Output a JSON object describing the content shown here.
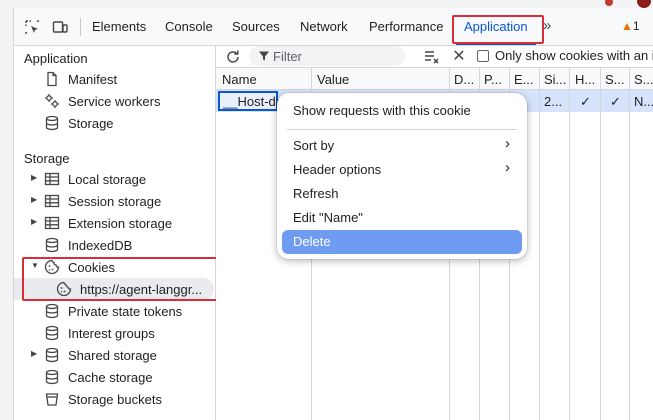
{
  "tabs": {
    "items": [
      {
        "label": "Elements",
        "active": false
      },
      {
        "label": "Console",
        "active": false
      },
      {
        "label": "Sources",
        "active": false
      },
      {
        "label": "Network",
        "active": false
      },
      {
        "label": "Performance",
        "active": false
      },
      {
        "label": "Application",
        "active": true
      }
    ],
    "more_icon": "double-chevron-right",
    "warning_count": "1",
    "accent": "#0b57d0",
    "highlight": "#d92d3a"
  },
  "sidebar": {
    "application_heading": "Application",
    "application_items": [
      {
        "label": "Manifest",
        "icon": "document-icon"
      },
      {
        "label": "Service workers",
        "icon": "gears-icon"
      },
      {
        "label": "Storage",
        "icon": "database-icon"
      }
    ],
    "storage_heading": "Storage",
    "storage_items": [
      {
        "label": "Local storage",
        "icon": "table-icon",
        "expandable": true
      },
      {
        "label": "Session storage",
        "icon": "table-icon",
        "expandable": true
      },
      {
        "label": "Extension storage",
        "icon": "table-icon",
        "expandable": true
      },
      {
        "label": "IndexedDB",
        "icon": "database-icon",
        "expandable": false
      },
      {
        "label": "Cookies",
        "icon": "cookie-icon",
        "expanded": true
      },
      {
        "label": "https://agent-langgr...",
        "icon": "cookie-icon",
        "selected": true
      },
      {
        "label": "Private state tokens",
        "icon": "database-icon"
      },
      {
        "label": "Interest groups",
        "icon": "database-icon"
      },
      {
        "label": "Shared storage",
        "icon": "database-icon",
        "expandable": true
      },
      {
        "label": "Cache storage",
        "icon": "database-icon"
      },
      {
        "label": "Storage buckets",
        "icon": "bucket-icon"
      }
    ]
  },
  "toolbar": {
    "filter_placeholder": "Filter",
    "only_issue_label": "Only show cookies with an is"
  },
  "table": {
    "columns": [
      "Name",
      "Value",
      "D...",
      "P...",
      "E...",
      "Si...",
      "H...",
      "S...",
      "S..."
    ],
    "row": {
      "name": "__Host-da",
      "cells": [
        "",
        "",
        "",
        "",
        "2...",
        "✓",
        "✓",
        "N..."
      ]
    }
  },
  "context_menu": {
    "items": [
      {
        "label": "Show requests with this cookie"
      },
      {
        "label": "Sort by",
        "submenu": true
      },
      {
        "label": "Header options",
        "submenu": true
      },
      {
        "label": "Refresh"
      },
      {
        "label": "Edit \"Name\""
      },
      {
        "label": "Delete",
        "active": true
      }
    ]
  }
}
